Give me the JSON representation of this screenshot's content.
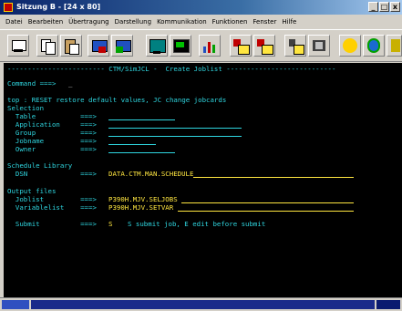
{
  "window": {
    "title": "Sitzung B - [24 x 80]",
    "minimize_label": "_",
    "maximize_label": "□",
    "close_label": "x"
  },
  "menu": [
    "Datei",
    "Bearbeiten",
    "Übertragung",
    "Darstellung",
    "Kommunikation",
    "Funktionen",
    "Fenster",
    "Hilfe"
  ],
  "toolbar": {
    "icons": [
      "print-icon",
      "copy-icon",
      "paste-icon",
      "send-icon",
      "receive-icon",
      "display-icon",
      "macro-icon",
      "chart-icon",
      "record-icon",
      "playback-icon",
      "stop-icon",
      "help-icon",
      "globe-icon",
      "settings-icon"
    ]
  },
  "screen": {
    "header": "------------------------ CTM/SimJCL -  Create Joblist ---------------------------",
    "command_label": "Command ===> ",
    "command_value": "_",
    "help_line": "top : RESET restore default values, JC change jobcards",
    "selection_title": "Selection",
    "table_label": "  Table           ===>",
    "application_label": "  Application     ===>",
    "group_label": "  Group           ===>",
    "jobname_label": "  Jobname         ===>",
    "owner_label": "  Owner           ===>",
    "schedule_title": "Schedule Library",
    "dsn_label": "  DSN             ===>",
    "dsn_value": "DATA.CTM.MAN.SCHEDULE",
    "output_title": "Output files",
    "joblist_label": "  Joblist         ===>",
    "joblist_value": "P390H.MJV.SELJOBS",
    "variablelist_label": "  Variablelist    ===>",
    "variablelist_value": "P390H.MJV.SETVAR",
    "submit_label": "  Submit          ===>",
    "submit_value": "S",
    "submit_help": "S submit job, E edit before submit"
  },
  "colors": {
    "terminal_bg": "#000000",
    "cyan": "#2fd6e0",
    "yellow": "#ffe640",
    "titlebar": "#0a246a"
  }
}
